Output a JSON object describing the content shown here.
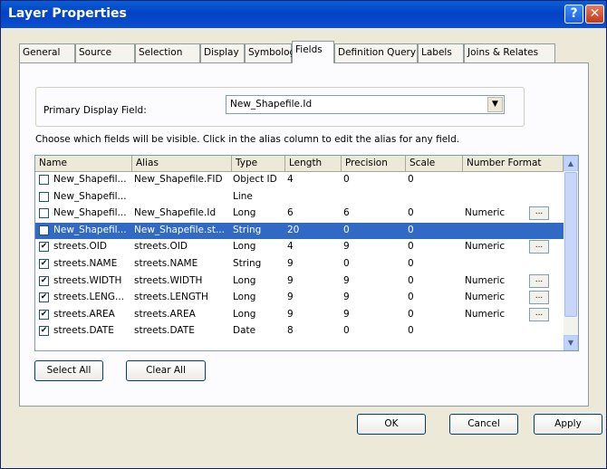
{
  "window": {
    "title": "Layer Properties",
    "help_glyph": "?",
    "close_glyph": "✕"
  },
  "tabs": [
    {
      "label": "General"
    },
    {
      "label": "Source"
    },
    {
      "label": "Selection"
    },
    {
      "label": "Display"
    },
    {
      "label": "Symbology"
    },
    {
      "label": "Fields"
    },
    {
      "label": "Definition Query"
    },
    {
      "label": "Labels"
    },
    {
      "label": "Joins & Relates"
    }
  ],
  "active_tab": "Fields",
  "primary_display_field": {
    "label": "Primary Display Field:",
    "value": "New_Shapefile.Id"
  },
  "instructions": "Choose which fields will be visible. Click in the alias column to edit the alias for any field.",
  "columns": [
    "Name",
    "Alias",
    "Type",
    "Length",
    "Precision",
    "Scale",
    "Number Format"
  ],
  "rows": [
    {
      "checked": false,
      "name": "New_Shapefil...",
      "alias": "New_Shapefile.FID",
      "type": "Object ID",
      "length": "4",
      "precision": "0",
      "scale": "0",
      "format": "",
      "has_button": false,
      "selected": false
    },
    {
      "checked": false,
      "name": "New_Shapefil...",
      "alias": "",
      "type": "Line",
      "length": "",
      "precision": "",
      "scale": "",
      "format": "",
      "has_button": false,
      "selected": false
    },
    {
      "checked": false,
      "name": "New_Shapefil...",
      "alias": "New_Shapefile.Id",
      "type": "Long",
      "length": "6",
      "precision": "6",
      "scale": "0",
      "format": "Numeric",
      "has_button": true,
      "selected": false
    },
    {
      "checked": false,
      "name": "New_Shapefil...",
      "alias": "New_Shapefile.st...",
      "type": "String",
      "length": "20",
      "precision": "0",
      "scale": "0",
      "format": "",
      "has_button": false,
      "selected": true
    },
    {
      "checked": true,
      "name": "streets.OID",
      "alias": "streets.OID",
      "type": "Long",
      "length": "4",
      "precision": "9",
      "scale": "0",
      "format": "Numeric",
      "has_button": true,
      "selected": false
    },
    {
      "checked": true,
      "name": "streets.NAME",
      "alias": "streets.NAME",
      "type": "String",
      "length": "9",
      "precision": "0",
      "scale": "0",
      "format": "",
      "has_button": false,
      "selected": false
    },
    {
      "checked": true,
      "name": "streets.WIDTH",
      "alias": "streets.WIDTH",
      "type": "Long",
      "length": "9",
      "precision": "9",
      "scale": "0",
      "format": "Numeric",
      "has_button": true,
      "selected": false
    },
    {
      "checked": true,
      "name": "streets.LENG...",
      "alias": "streets.LENGTH",
      "type": "Long",
      "length": "9",
      "precision": "9",
      "scale": "0",
      "format": "Numeric",
      "has_button": true,
      "selected": false
    },
    {
      "checked": true,
      "name": "streets.AREA",
      "alias": "streets.AREA",
      "type": "Long",
      "length": "9",
      "precision": "9",
      "scale": "0",
      "format": "Numeric",
      "has_button": true,
      "selected": false
    },
    {
      "checked": true,
      "name": "streets.DATE",
      "alias": "streets.DATE",
      "type": "Date",
      "length": "8",
      "precision": "0",
      "scale": "0",
      "format": "",
      "has_button": false,
      "selected": false
    }
  ],
  "format_button_label": "...",
  "check_glyph": "✔",
  "buttons": {
    "select_all": "Select All",
    "clear_all": "Clear All",
    "ok": "OK",
    "cancel": "Cancel",
    "apply": "Apply"
  },
  "scroll": {
    "up_glyph": "▲",
    "down_glyph": "▼"
  },
  "combo_arrow_glyph": "▼",
  "colors": {
    "selection": "#316ac5",
    "titlebar": "#0342c4",
    "dialog_bg": "#ece9d8"
  }
}
